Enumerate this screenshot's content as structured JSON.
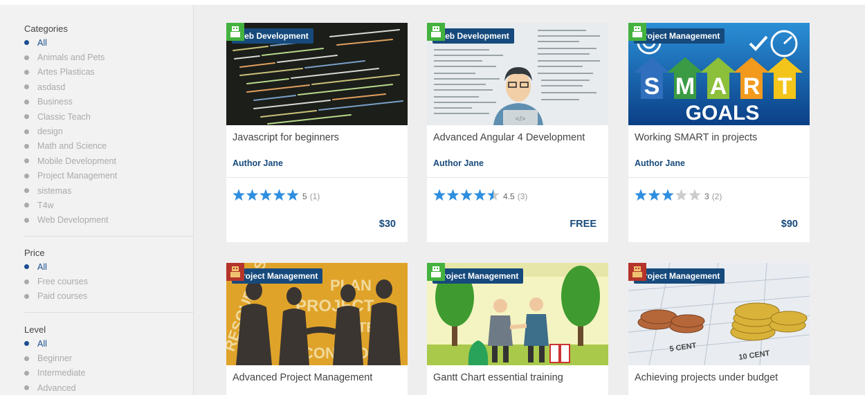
{
  "filters": {
    "categories": {
      "title": "Categories",
      "items": [
        "All",
        "Animals and Pets",
        "Artes Plasticas",
        "asdasd",
        "Business",
        "Classic Teach",
        "design",
        "Math and Science",
        "Mobile Development",
        "Project Management",
        "sistemas",
        "T4w",
        "Web Development"
      ],
      "selected": "All"
    },
    "price": {
      "title": "Price",
      "items": [
        "All",
        "Free courses",
        "Paid courses"
      ],
      "selected": "All"
    },
    "level": {
      "title": "Level",
      "items": [
        "All",
        "Beginner",
        "Intermediate",
        "Advanced"
      ],
      "selected": "All"
    }
  },
  "courses": [
    {
      "category": "Web Development",
      "title": "Javascript for beginners",
      "author": "Author Jane",
      "rating": 5,
      "rating_text": "5",
      "reviews": "(1)",
      "price": "$30"
    },
    {
      "category": "Web Development",
      "title": "Advanced Angular 4 Development",
      "author": "Author Jane",
      "rating": 4.5,
      "rating_text": "4.5",
      "reviews": "(3)",
      "price": "FREE"
    },
    {
      "category": "Project Management",
      "title": "Working SMART in projects",
      "author": "Author Jane",
      "rating": 3,
      "rating_text": "3",
      "reviews": "(2)",
      "price": "$90"
    },
    {
      "category": "Project Management",
      "title": "Advanced Project Management",
      "author": "",
      "rating": null,
      "rating_text": "",
      "reviews": "",
      "price": ""
    },
    {
      "category": "Project Management",
      "title": "Gantt Chart essential training",
      "author": "",
      "rating": null,
      "rating_text": "",
      "reviews": "",
      "price": ""
    },
    {
      "category": "Project Management",
      "title": "Achieving projects under budget",
      "author": "",
      "rating": null,
      "rating_text": "",
      "reviews": "",
      "price": ""
    }
  ],
  "thumbnails": {
    "smart_letters": [
      "S",
      "M",
      "A",
      "R",
      "T"
    ],
    "smart_goals": "GOALS",
    "code_tag": "</>",
    "coin_label_1": "5 CENT",
    "coin_label_2": "10 CENT",
    "pm_words": [
      "RESOURCES",
      "PLAN",
      "PROJECT",
      "CONTROL",
      "TEAM"
    ]
  },
  "colors": {
    "accent": "#174a7c",
    "selected": "#1b4e8f",
    "star": "#2e8fe0",
    "star_empty": "#cccccc"
  }
}
